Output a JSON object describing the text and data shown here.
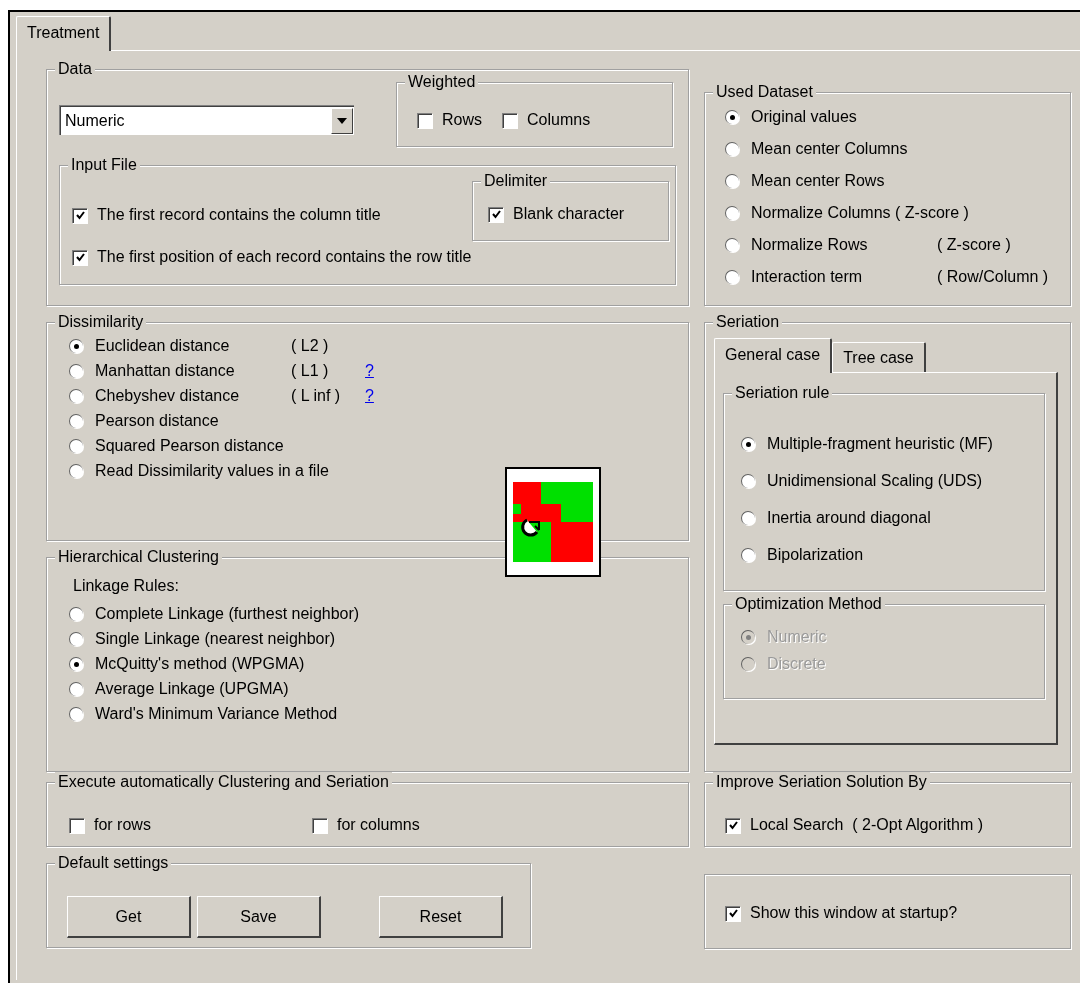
{
  "tabs": [
    {
      "label": "Treatment",
      "selected": true
    }
  ],
  "data": {
    "title": "Data",
    "type_select": {
      "value": "Numeric"
    },
    "weighted": {
      "title": "Weighted",
      "options": [
        {
          "label": "Rows",
          "checked": false
        },
        {
          "label": "Columns",
          "checked": false
        }
      ]
    },
    "input_file": {
      "title": "Input File",
      "options": [
        {
          "label": "The first record contains the column title",
          "checked": true
        },
        {
          "label": "The first position of each record contains the row title",
          "checked": true
        }
      ],
      "delimiter": {
        "title": "Delimiter",
        "options": [
          {
            "label": "Blank character",
            "checked": true
          }
        ]
      }
    }
  },
  "used_dataset": {
    "title": "Used Dataset",
    "options": [
      {
        "label": "Original values",
        "selected": true
      },
      {
        "label": "Mean center Columns",
        "selected": false
      },
      {
        "label": "Mean center Rows",
        "selected": false
      },
      {
        "label": "Normalize Columns ( Z-score )",
        "selected": false
      },
      {
        "label": "Normalize Rows",
        "note": "( Z-score )",
        "selected": false
      },
      {
        "label": "Interaction term",
        "note": "( Row/Column )",
        "selected": false
      }
    ]
  },
  "dissimilarity": {
    "title": "Dissimilarity",
    "options": [
      {
        "label": "Euclidean distance",
        "note": "( L2 )",
        "selected": true
      },
      {
        "label": "Manhattan distance",
        "note": "( L1 )",
        "help": "?",
        "selected": false
      },
      {
        "label": "Chebyshev distance",
        "note": "( L inf )",
        "help": "?",
        "selected": false
      },
      {
        "label": "Pearson distance",
        "selected": false
      },
      {
        "label": "Squared Pearson distance",
        "selected": false
      },
      {
        "label": "Read Dissimilarity values in a file",
        "selected": false
      }
    ]
  },
  "hierarchical_clustering": {
    "title": "Hierarchical Clustering",
    "subtitle": "Linkage Rules:",
    "options": [
      {
        "label": "Complete Linkage (furthest neighbor)",
        "selected": false
      },
      {
        "label": "Single Linkage (nearest neighbor)",
        "selected": false
      },
      {
        "label": "McQuitty's method (WPGMA)",
        "selected": true
      },
      {
        "label": "Average Linkage (UPGMA)",
        "selected": false
      },
      {
        "label": "Ward's Minimum Variance Method",
        "selected": false
      }
    ]
  },
  "seriation": {
    "title": "Seriation",
    "tabs": [
      {
        "label": "General case",
        "selected": true
      },
      {
        "label": "Tree case",
        "selected": false
      }
    ],
    "rule": {
      "title": "Seriation rule",
      "options": [
        {
          "label": "Multiple-fragment heuristic (MF)",
          "selected": true
        },
        {
          "label": "Unidimensional Scaling (UDS)",
          "selected": false
        },
        {
          "label": "Inertia around diagonal",
          "selected": false
        },
        {
          "label": "Bipolarization",
          "selected": false
        }
      ]
    },
    "optimization": {
      "title": "Optimization Method",
      "disabled": true,
      "options": [
        {
          "label": "Numeric",
          "selected": true
        },
        {
          "label": "Discrete",
          "selected": false
        }
      ]
    }
  },
  "execute": {
    "title": "Execute automatically Clustering and Seriation",
    "options": [
      {
        "label": "for rows",
        "checked": false
      },
      {
        "label": "for columns",
        "checked": false
      }
    ]
  },
  "improve": {
    "title": "Improve Seriation Solution By",
    "options": [
      {
        "label": "Local Search  ( 2-Opt Algorithm )",
        "checked": true
      }
    ]
  },
  "default_settings": {
    "title": "Default settings",
    "buttons": [
      "Get",
      "Save",
      "Reset"
    ]
  },
  "startup": {
    "label": "Show this window at startup?",
    "checked": true
  }
}
